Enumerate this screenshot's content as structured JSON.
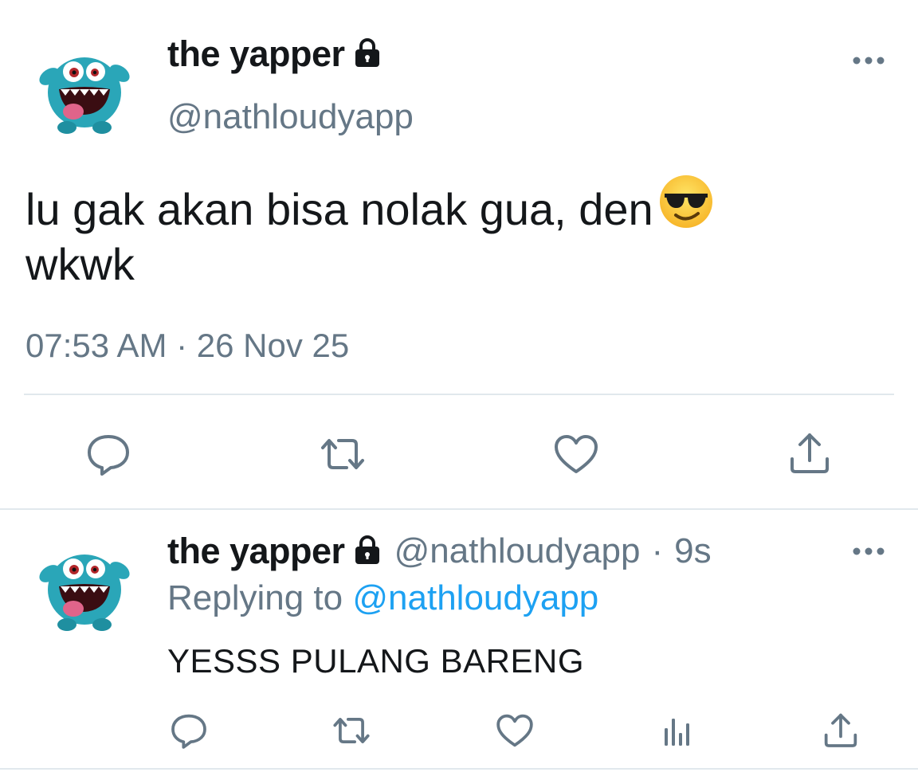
{
  "main_tweet": {
    "display_name": "the yapper",
    "handle": "@nathloudyapp",
    "text_line1": "lu gak akan bisa nolak gua, den",
    "text_line2": "wkwk",
    "emoji": "smiling-face-with-sunglasses",
    "timestamp": "07:53 AM · 26 Nov 25",
    "actions": [
      "reply-icon",
      "retweet-icon",
      "like-icon",
      "share-icon"
    ]
  },
  "reply_tweet": {
    "display_name": "the yapper",
    "handle": "@nathloudyapp",
    "separator": "·",
    "age": "9s",
    "replying_prefix": "Replying to",
    "replying_handle": "@nathloudyapp",
    "text": "YESSS PULANG BARENG",
    "actions": [
      "reply-icon",
      "retweet-icon",
      "like-icon",
      "analytics-icon",
      "share-icon"
    ]
  },
  "colors": {
    "text": "#14171a",
    "secondary": "#657786",
    "link": "#1da1f2",
    "divider": "#e1e8ed",
    "avatar_fur": "#2aa6b8"
  }
}
